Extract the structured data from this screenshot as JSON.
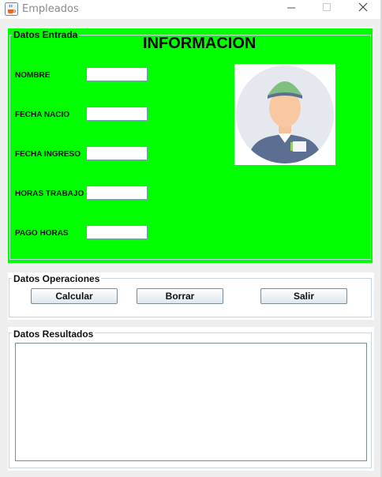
{
  "window": {
    "title": "Empleados",
    "icon": "java-coffee-icon",
    "controls": [
      "minimize-icon",
      "maximize-icon",
      "close-icon"
    ]
  },
  "entrada": {
    "legend": "Datos Entrada",
    "heading": "INFORMACION",
    "fields": [
      {
        "label": "NOMBRE",
        "value": ""
      },
      {
        "label": "FECHA NACIO",
        "value": ""
      },
      {
        "label": "FECHA INGRESO",
        "value": ""
      },
      {
        "label": "HORAS TRABAJO",
        "value": ""
      },
      {
        "label": "PAGO HORAS",
        "value": ""
      }
    ],
    "image": "employee-avatar-icon"
  },
  "operaciones": {
    "legend": "Datos Operaciones",
    "buttons": [
      {
        "label": "Calcular"
      },
      {
        "label": "Borrar"
      },
      {
        "label": "Salir"
      }
    ]
  },
  "resultados": {
    "legend": "Datos Resultados",
    "output": ""
  },
  "colors": {
    "panel_green": "#00ff00",
    "window_bg": "#eeeeee",
    "border": "#c6d6e3"
  }
}
